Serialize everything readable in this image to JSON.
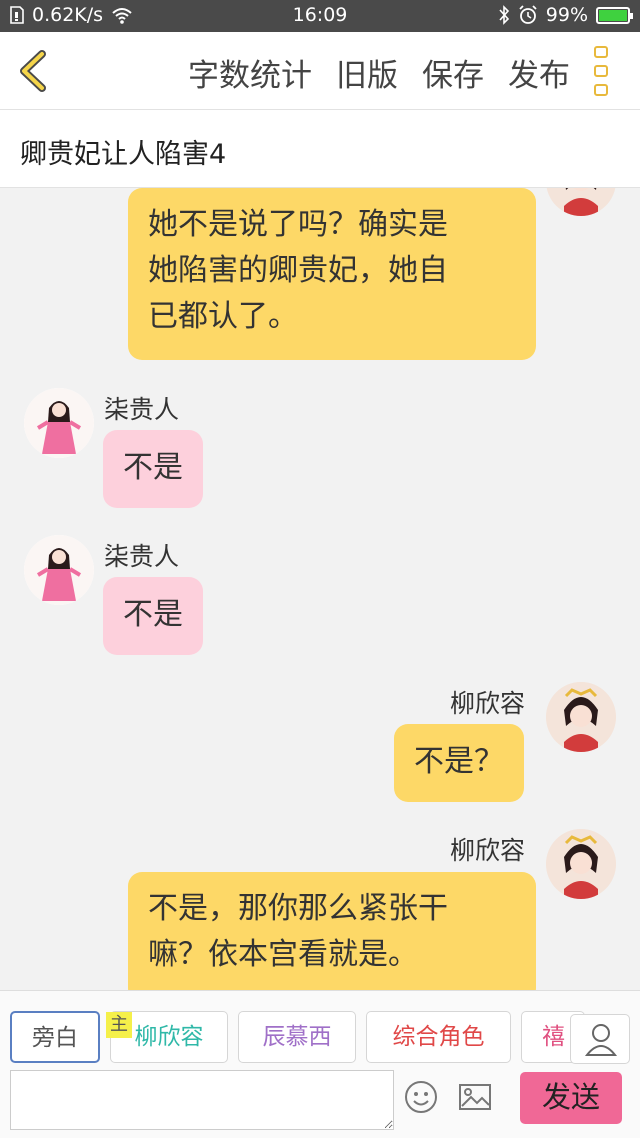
{
  "status_bar": {
    "net_speed": "0.62K/s",
    "time": "16:09",
    "battery": "99%",
    "battery_level": 0.99
  },
  "header": {
    "actions": [
      "字数统计",
      "旧版",
      "保存",
      "发布"
    ]
  },
  "title": "卿贵妃让人陷害4",
  "messages": [
    {
      "side": "right",
      "name": "",
      "text_lines": [
        "她不是说了吗？确实是",
        "她陷害的卿贵妃，她自",
        "已都认了。"
      ],
      "color": "yellow"
    },
    {
      "side": "left",
      "name": "柒贵人",
      "text_lines": [
        "不是"
      ],
      "color": "pink"
    },
    {
      "side": "left",
      "name": "柒贵人",
      "text_lines": [
        "不是"
      ],
      "color": "pink"
    },
    {
      "side": "right",
      "name": "柳欣容",
      "text_lines": [
        "不是？"
      ],
      "color": "yellow"
    },
    {
      "side": "right",
      "name": "柳欣容",
      "text_lines": [
        "不是，那你那么紧张干",
        "嘛？依本宫看就是。"
      ],
      "color": "yellow"
    }
  ],
  "roles": [
    {
      "label": "旁白",
      "color": "#555555",
      "active": true
    },
    {
      "label": "柳欣容",
      "color": "#2fb8a8",
      "active": false
    },
    {
      "label": "辰慕西",
      "color": "#a070c8",
      "active": false
    },
    {
      "label": "综合角色",
      "color": "#e04848",
      "active": false
    },
    {
      "label": "禧",
      "color": "#e05080",
      "active": false
    }
  ],
  "role_badge": "主",
  "input": {
    "value": "",
    "placeholder": ""
  },
  "send_label": "发送",
  "colors": {
    "accent_yellow": "#fdd867",
    "pink_bubble": "#fdd0dc",
    "send_button": "#f06896",
    "icon_gold": "#e8b93c"
  },
  "icons": [
    "sim-icon",
    "wifi-icon",
    "bluetooth-icon",
    "alarm-icon",
    "battery-icon",
    "back-arrow-icon",
    "menu-dots-icon",
    "user-icon",
    "emoji-icon",
    "image-icon"
  ]
}
